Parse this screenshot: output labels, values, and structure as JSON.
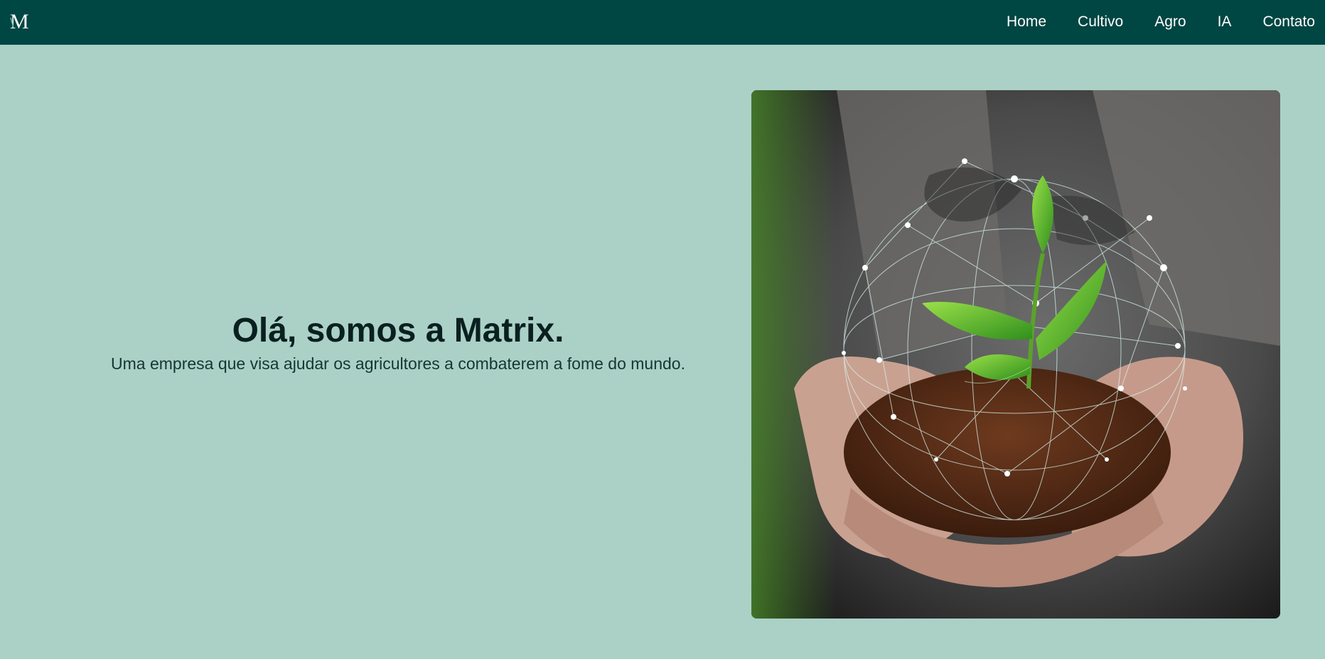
{
  "navbar": {
    "logo": {
      "icon": "matrix-m-logo-icon",
      "glyph": "M"
    },
    "links": [
      {
        "label": "Home"
      },
      {
        "label": "Cultivo"
      },
      {
        "label": "Agro"
      },
      {
        "label": "IA"
      },
      {
        "label": "Contato"
      }
    ],
    "background": "#004643",
    "link_color": "#ffffff"
  },
  "hero": {
    "title": "Olá, somos a Matrix.",
    "subtitle": "Uma empresa que visa ajudar os agricultores a combaterem a fome do mundo.",
    "image": {
      "icon": "hands-holding-soil-sprout-globe-image"
    }
  },
  "colors": {
    "page_background": "#abd1c6",
    "title": "#0a2020"
  }
}
